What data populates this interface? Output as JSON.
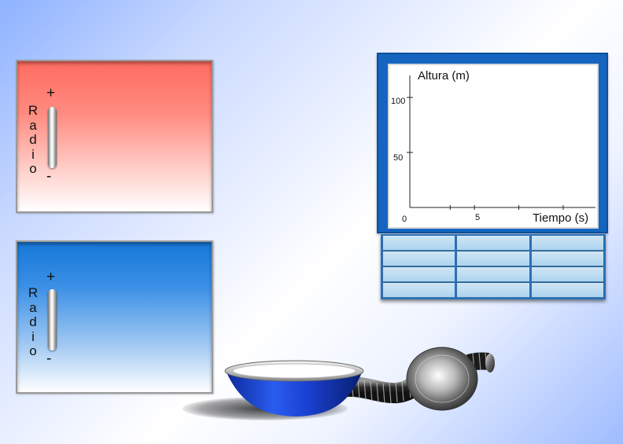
{
  "panels": [
    {
      "id": "top",
      "radio_label": [
        "R",
        "a",
        "d",
        "i",
        "o"
      ],
      "plus": "+",
      "minus": "-",
      "slider_level": 0.5
    },
    {
      "id": "bottom",
      "radio_label": [
        "R",
        "a",
        "d",
        "i",
        "o"
      ],
      "plus": "+",
      "minus": "-",
      "slider_level": 0.5
    }
  ],
  "chart_data": {
    "type": "line",
    "ylabel": "Altura (m)",
    "xlabel": "Tiempo (s)",
    "y_ticks": [
      "100",
      "50"
    ],
    "x_ticks": [
      "0",
      "5"
    ],
    "xlim": [
      0,
      23
    ],
    "ylim": [
      0,
      120
    ],
    "series": []
  },
  "table": {
    "columns": 3,
    "rows": 4,
    "cells": [
      [
        "",
        "",
        ""
      ],
      [
        "",
        "",
        ""
      ],
      [
        "",
        "",
        ""
      ],
      [
        "",
        "",
        ""
      ]
    ]
  },
  "colors": {
    "panel_top": "#ff6b60",
    "panel_bottom": "#1677d8",
    "graph_frame": "#1565c0",
    "bowl": "#1a3fd0"
  }
}
